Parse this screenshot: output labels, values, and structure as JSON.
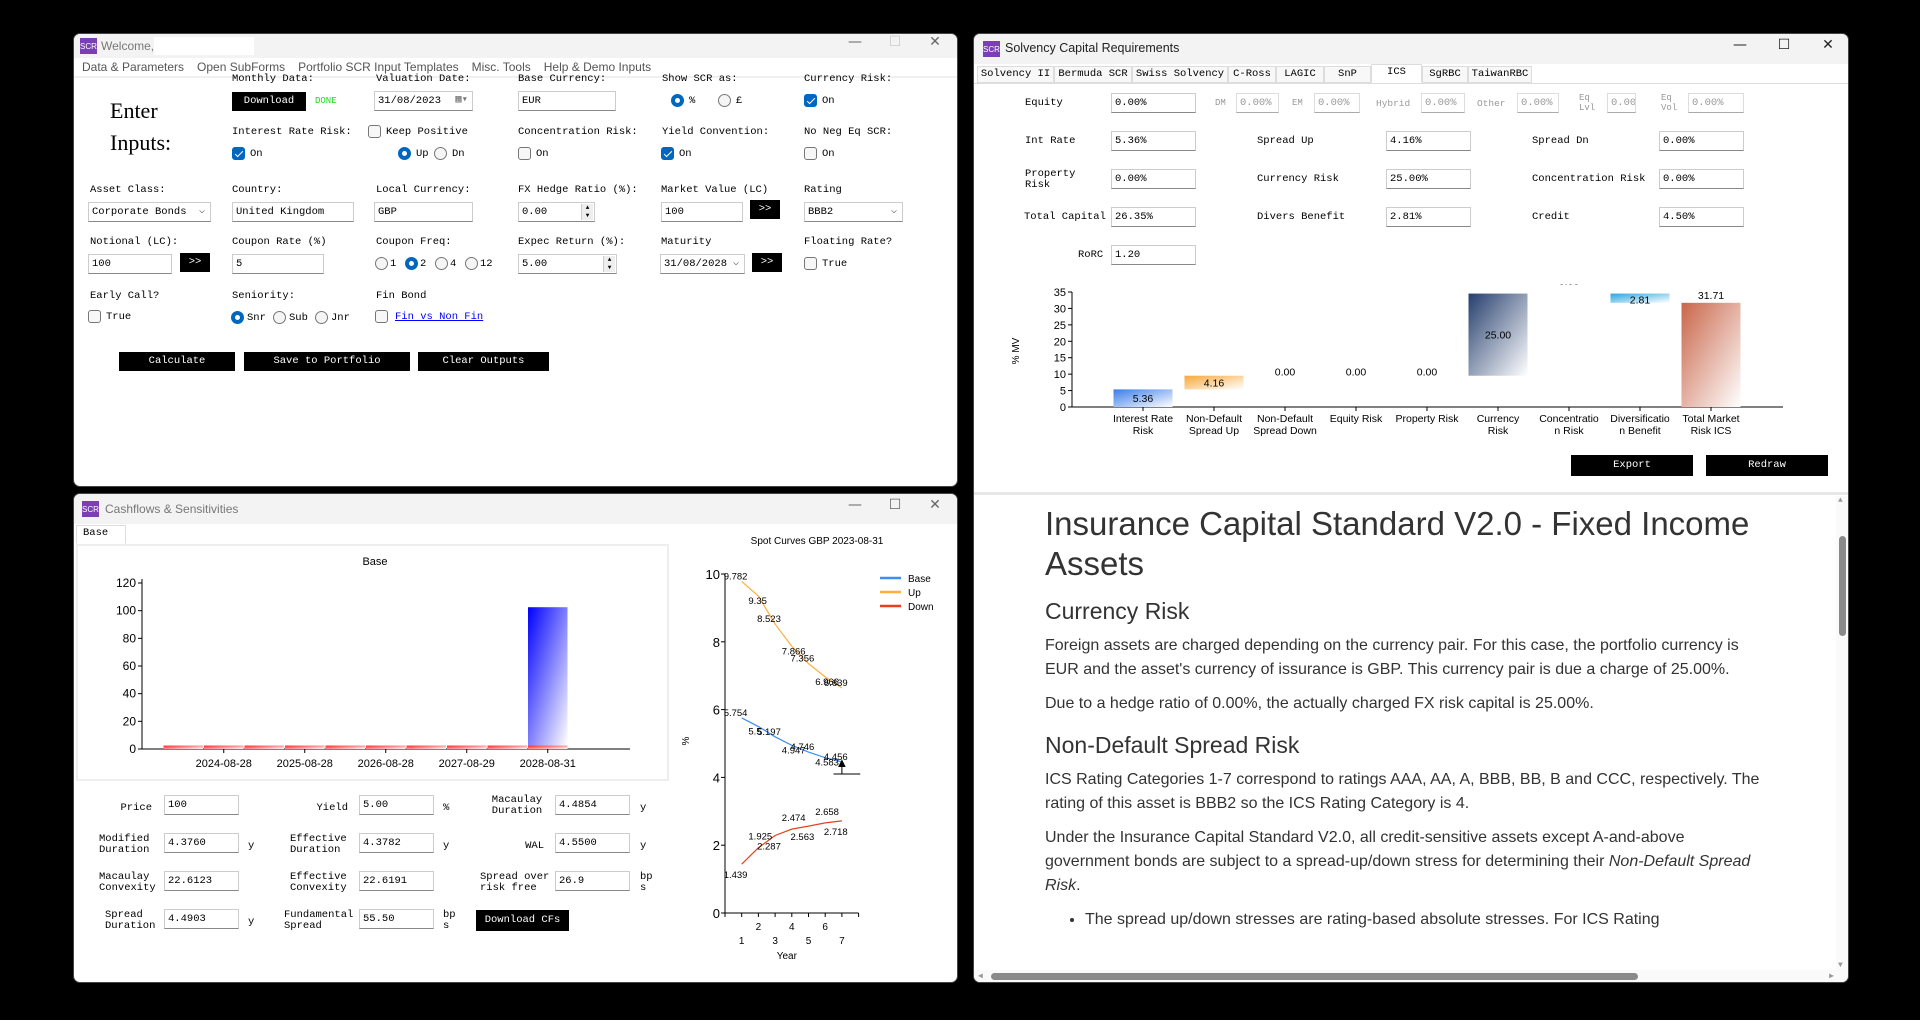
{
  "main": {
    "title": "Welcome,",
    "menu": [
      "Data & Parameters",
      "Open SubForms",
      "Portfolio SCR Input Templates",
      "Misc. Tools",
      "Help & Demo Inputs"
    ],
    "heading1": "Enter",
    "heading2": "Inputs:",
    "monthly_label": "Monthly Data:",
    "download_label": "Download",
    "done": "DONE",
    "valuation_label": "Valuation Date:",
    "valuation_value": "31/08/2023",
    "base_ccy_label": "Base Currency:",
    "base_ccy_value": "EUR",
    "show_scr_label": "Show SCR as:",
    "show_pct": "%",
    "show_gbp": "£",
    "ccy_risk_label": "Currency Risk:",
    "on": "On",
    "true": "True",
    "ir_risk_label": "Interest Rate Risk:",
    "keep_positive": "Keep Positive",
    "up": "Up",
    "dn": "Dn",
    "conc_label": "Concentration Risk:",
    "yield_conv_label": "Yield Convention:",
    "no_neg_label": "No Neg Eq SCR:",
    "asset_class_label": "Asset Class:",
    "asset_class_value": "Corporate Bonds",
    "country_label": "Country:",
    "country_value": "United Kingdom",
    "local_ccy_label": "Local Currency:",
    "local_ccy_value": "GBP",
    "fx_hedge_label": "FX Hedge Ratio (%):",
    "fx_hedge_value": "0.00",
    "mv_label": "Market Value (LC)",
    "mv_value": "100",
    "go": ">>",
    "rating_label": "Rating",
    "rating_value": "BBB2",
    "notional_label": "Notional (LC):",
    "notional_value": "100",
    "coupon_label": "Coupon Rate (%)",
    "coupon_value": "5",
    "freq_label": "Coupon Freq:",
    "freq_options": [
      "1",
      "2",
      "4",
      "12"
    ],
    "freq_selected": "2",
    "exp_ret_label": "Expec Return (%):",
    "exp_ret_value": "5.00",
    "maturity_label": "Maturity",
    "maturity_value": "31/08/2028",
    "floating_label": "Floating Rate?",
    "early_call_label": "Early Call?",
    "seniority_label": "Seniority:",
    "seniority_options": [
      "Snr",
      "Sub",
      "Jnr"
    ],
    "fin_bond_label": "Fin Bond",
    "fin_link": "Fin vs Non Fin",
    "calculate": "Calculate",
    "save": "Save to Portfolio",
    "clear": "Clear Outputs"
  },
  "cashflows": {
    "title": "Cashflows & Sensitivities",
    "tab": "Base",
    "fields": {
      "price": {
        "label": "Price",
        "value": "100"
      },
      "yield": {
        "label": "Yield",
        "value": "5.00",
        "unit": "%"
      },
      "mac_dur": {
        "label": "Macaulay Duration",
        "value": "4.4854",
        "unit": "y"
      },
      "mod_dur": {
        "label": "Modified Duration",
        "value": "4.3760",
        "unit": "y"
      },
      "eff_dur": {
        "label": "Effective Duration",
        "value": "4.3782",
        "unit": "y"
      },
      "wal": {
        "label": "WAL",
        "value": "4.5500",
        "unit": "y"
      },
      "mac_conv": {
        "label": "Macaulay Convexity",
        "value": "22.6123"
      },
      "eff_conv": {
        "label": "Effective Convexity",
        "value": "22.6191"
      },
      "spread_rf": {
        "label": "Spread over risk free",
        "value": "26.9",
        "unit": "bps"
      },
      "spread_dur": {
        "label": "Spread Duration",
        "value": "4.4903",
        "unit": "y"
      },
      "fund_spread": {
        "label": "Fundamental Spread",
        "value": "55.50",
        "unit": "bps"
      }
    },
    "download": "Download CFs"
  },
  "scr": {
    "title": "Solvency Capital Requirements",
    "tabs": [
      "Solvency II",
      "Bermuda SCR",
      "Swiss Solvency",
      "C-Ross",
      "LAGIC",
      "SnP",
      "ICS",
      "SgRBC",
      "TaiwanRBC"
    ],
    "active_tab": "ICS",
    "equity": {
      "label": "Equity",
      "value": "0.00%"
    },
    "dm": {
      "label": "DM",
      "value": "0.00%"
    },
    "em": {
      "label": "EM",
      "value": "0.00%"
    },
    "hybrid": {
      "label": "Hybrid",
      "value": "0.00%"
    },
    "other": {
      "label": "Other",
      "value": "0.00%"
    },
    "eq_lvl": {
      "label": "Eq Lvl",
      "value": "0.00"
    },
    "eq_vol": {
      "label": "Eq Vol",
      "value": "0.00%"
    },
    "int_rate": {
      "label": "Int Rate",
      "value": "5.36%"
    },
    "spread_up": {
      "label": "Spread Up",
      "value": "4.16%"
    },
    "spread_dn": {
      "label": "Spread Dn",
      "value": "0.00%"
    },
    "property": {
      "label": "Property Risk",
      "value": "0.00%"
    },
    "currency": {
      "label": "Currency Risk",
      "value": "25.00%"
    },
    "concentration": {
      "label": "Concentration Risk",
      "value": "0.00%"
    },
    "total": {
      "label": "Total Capital",
      "value": "26.35%"
    },
    "divers": {
      "label": "Divers Benefit",
      "value": "2.81%"
    },
    "credit": {
      "label": "Credit",
      "value": "4.50%"
    },
    "rorc": {
      "label": "RoRC",
      "value": "1.20"
    },
    "export": "Export",
    "redraw": "Redraw"
  },
  "doc": {
    "h1": "Insurance Capital Standard V2.0 - Fixed Income Assets",
    "h2a": "Currency Risk",
    "p1": "Foreign assets are charged depending on the currency pair. For this case, the portfolio currency is EUR and the asset's currency of issurance is GBP. This currency pair is due a charge of 25.00%.",
    "p2": "Due to a hedge ratio of 0.00%, the actually charged FX risk capital is 25.00%.",
    "h2b": "Non-Default Spread Risk",
    "p3": "ICS Rating Categories 1-7 correspond to ratings AAA, AA, A, BBB, BB, B and CCC, respectively. The rating of this asset is BBB2 so the ICS Rating Category is 4.",
    "p4a": "Under the Insurance Capital Standard V2.0, all credit-sensitive assets except A-and-above government bonds are subject to a spread-up/down stress for determining their ",
    "p4b": "Non-Default Spread Risk",
    "p4c": ".",
    "bullet1": "The spread up/down stresses are rating-based absolute stresses. For ICS Rating"
  },
  "chart_data": [
    {
      "type": "bar",
      "title": "Base",
      "stacked": true,
      "x_tick_labels": [
        "2024-08-28",
        "2025-08-28",
        "2026-08-28",
        "2027-08-29",
        "2028-08-31"
      ],
      "series": [
        {
          "values": [
            2.5,
            2.5,
            2.5,
            2.5,
            2.5,
            2.5,
            2.5,
            2.5,
            2.5,
            2.5
          ],
          "color": "#ff2020"
        },
        {
          "values": [
            0,
            0,
            0,
            0,
            0,
            0,
            0,
            0,
            0,
            100
          ],
          "color": "#0000ff"
        }
      ],
      "ylim": [
        0,
        120
      ],
      "yticks": [
        0,
        20,
        40,
        60,
        80,
        100,
        120
      ]
    },
    {
      "type": "line",
      "title": "Spot Curves GBP 2023-08-31",
      "xlabel": "Year",
      "ylabel": "%",
      "x": [
        1,
        2,
        3,
        4,
        5,
        6,
        7
      ],
      "xlim": [
        0,
        8
      ],
      "ylim": [
        0,
        10
      ],
      "yticks": [
        0,
        2,
        4,
        6,
        8,
        10
      ],
      "legend": "top-right",
      "series": [
        {
          "name": "Base",
          "color": "#3d8ef0",
          "values": [
            5.754,
            5.5,
            5.197,
            4.947,
            4.746,
            4.583,
            4.456
          ]
        },
        {
          "name": "Up",
          "color": "#ffae3c",
          "values": [
            9.782,
            9.35,
            8.523,
            7.866,
            7.356,
            6.966,
            6.639
          ]
        },
        {
          "name": "Down",
          "color": "#e8401c",
          "values": [
            1.439,
            1.925,
            2.287,
            2.474,
            2.563,
            2.658,
            2.718
          ]
        }
      ]
    },
    {
      "type": "waterfall",
      "ylabel": "% MV",
      "ylim": [
        0,
        35
      ],
      "yticks": [
        0,
        5,
        10,
        15,
        20,
        25,
        30,
        35
      ],
      "categories": [
        [
          "Interest Rate",
          "Risk"
        ],
        [
          "Non-Default",
          "Spread Up"
        ],
        [
          "Non-Default",
          "Spread Down"
        ],
        [
          "Equity Risk"
        ],
        [
          "Property Risk"
        ],
        [
          "Currency",
          "Risk"
        ],
        [
          "Concentratio",
          "n Risk"
        ],
        [
          "Diversificatio",
          "n Benefit"
        ],
        [
          "Total Market",
          "Risk ICS"
        ]
      ],
      "values": [
        5.36,
        4.16,
        0.0,
        0.0,
        0.0,
        25.0,
        0.0,
        -2.81,
        31.71
      ],
      "labels": [
        "5.36",
        "4.16",
        "0.00",
        "0.00",
        "0.00",
        "25.00",
        "0.00",
        "2.81",
        "31.71"
      ],
      "colors": [
        "#3a7de8",
        "#f7a83a",
        "",
        "",
        "",
        "#263f6e",
        "",
        "#2aa6e0",
        "#c9664a"
      ]
    }
  ]
}
